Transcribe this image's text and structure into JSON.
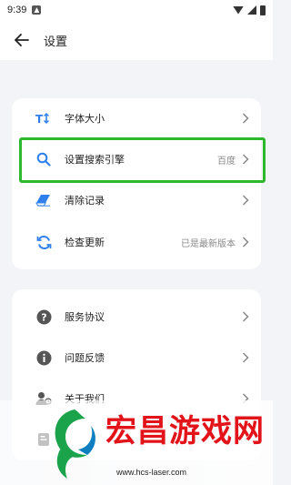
{
  "status_bar": {
    "time": "9:39"
  },
  "header": {
    "title": "设置"
  },
  "card1": {
    "items": [
      {
        "label": "字体大小",
        "value": ""
      },
      {
        "label": "设置搜索引擎",
        "value": "百度"
      },
      {
        "label": "清除记录",
        "value": ""
      },
      {
        "label": "检查更新",
        "value": "已是最新版本"
      }
    ]
  },
  "card2": {
    "items": [
      {
        "label": "服务协议"
      },
      {
        "label": "问题反馈"
      },
      {
        "label": "关于我们"
      }
    ]
  },
  "watermark": {
    "title": "宏昌游戏网",
    "url": "www.hcs-laser.com"
  },
  "colors": {
    "accent": "#2f80ed",
    "highlight": "#2eb82e",
    "watermark_red": "#e2141a",
    "background": "#f3f4f7"
  }
}
